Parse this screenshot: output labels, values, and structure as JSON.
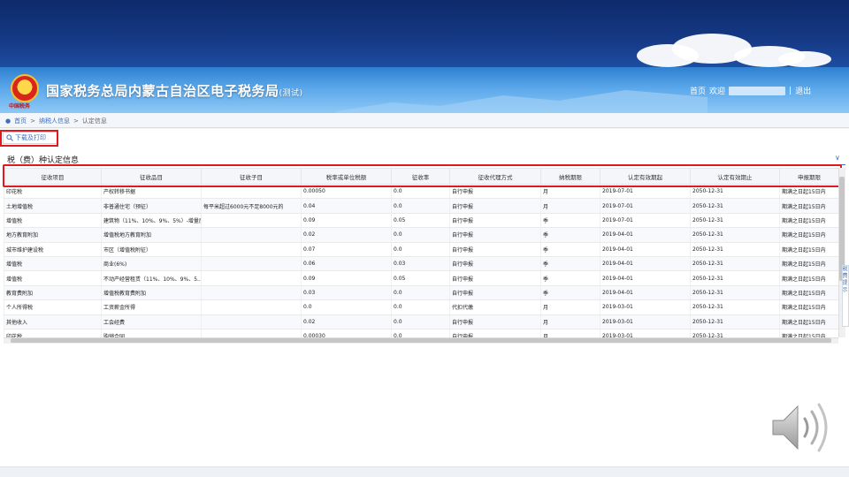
{
  "site": {
    "title": "国家税务总局内蒙古自治区电子税务局",
    "title_suffix": "(测试)",
    "emblem_caption": "中国税务",
    "home_link": "首页",
    "welcome": "欢迎",
    "separator": "|",
    "logout": "退出"
  },
  "breadcrumb": [
    "首页",
    ">",
    "纳税人信息",
    ">",
    "认定信息"
  ],
  "toolbar": {
    "download_print": "下载及打印"
  },
  "section": {
    "title": "税（费）种认定信息"
  },
  "side_tab": "税 费 提 示",
  "table": {
    "columns": [
      "征收项目",
      "征收品目",
      "征收子目",
      "税率或单位税额",
      "征收率",
      "征收代理方式",
      "纳税期限",
      "认定有效期起",
      "认定有效期止",
      "申报期限"
    ],
    "rows": [
      [
        "印花税",
        "产权转移书据",
        "",
        "0.00050",
        "0.0",
        "自行申报",
        "月",
        "2019-07-01",
        "2050-12-31",
        "期满之日起15日内"
      ],
      [
        "土地增值税",
        "非普通住宅（预征）",
        "每平米超过6000元不足8000元的",
        "0.04",
        "0.0",
        "自行申报",
        "月",
        "2019-07-01",
        "2050-12-31",
        "期满之日起15日内"
      ],
      [
        "增值税",
        "建筑物（11%、10%、9%、5%）-增量房",
        "",
        "0.09",
        "0.05",
        "自行申报",
        "季",
        "2019-07-01",
        "2050-12-31",
        "期满之日起15日内"
      ],
      [
        "地方教育附加",
        "增值税地方教育附加",
        "",
        "0.02",
        "0.0",
        "自行申报",
        "季",
        "2019-04-01",
        "2050-12-31",
        "期满之日起15日内"
      ],
      [
        "城市维护建设税",
        "市区（增值税附征）",
        "",
        "0.07",
        "0.0",
        "自行申报",
        "季",
        "2019-04-01",
        "2050-12-31",
        "期满之日起15日内"
      ],
      [
        "增值税",
        "商业(6%)",
        "",
        "0.06",
        "0.03",
        "自行申报",
        "季",
        "2019-04-01",
        "2050-12-31",
        "期满之日起15日内"
      ],
      [
        "增值税",
        "不动产经营租赁（11%、10%、9%、5...",
        "",
        "0.09",
        "0.05",
        "自行申报",
        "季",
        "2019-04-01",
        "2050-12-31",
        "期满之日起15日内"
      ],
      [
        "教育费附加",
        "增值税教育费附加",
        "",
        "0.03",
        "0.0",
        "自行申报",
        "季",
        "2019-04-01",
        "2050-12-31",
        "期满之日起15日内"
      ],
      [
        "个人所得税",
        "工资薪金所得",
        "",
        "0.0",
        "0.0",
        "代扣代缴",
        "月",
        "2019-03-01",
        "2050-12-31",
        "期满之日起15日内"
      ],
      [
        "其他收入",
        "工会经费",
        "",
        "0.02",
        "0.0",
        "自行申报",
        "月",
        "2019-03-01",
        "2050-12-31",
        "期满之日起15日内"
      ],
      [
        "印花税",
        "购销合同",
        "",
        "0.00030",
        "0.0",
        "自行申报",
        "月",
        "2019-03-01",
        "2050-12-31",
        "期满之日起15日内"
      ]
    ]
  },
  "colors": {
    "highlight": "#e0191e",
    "accent": "#3a6fc2",
    "banner": "#163a86"
  },
  "icons": {
    "download": "search-icon",
    "location": "location-pin-icon",
    "speaker": "speaker-icon",
    "collapse": "chevron-down-icon"
  }
}
